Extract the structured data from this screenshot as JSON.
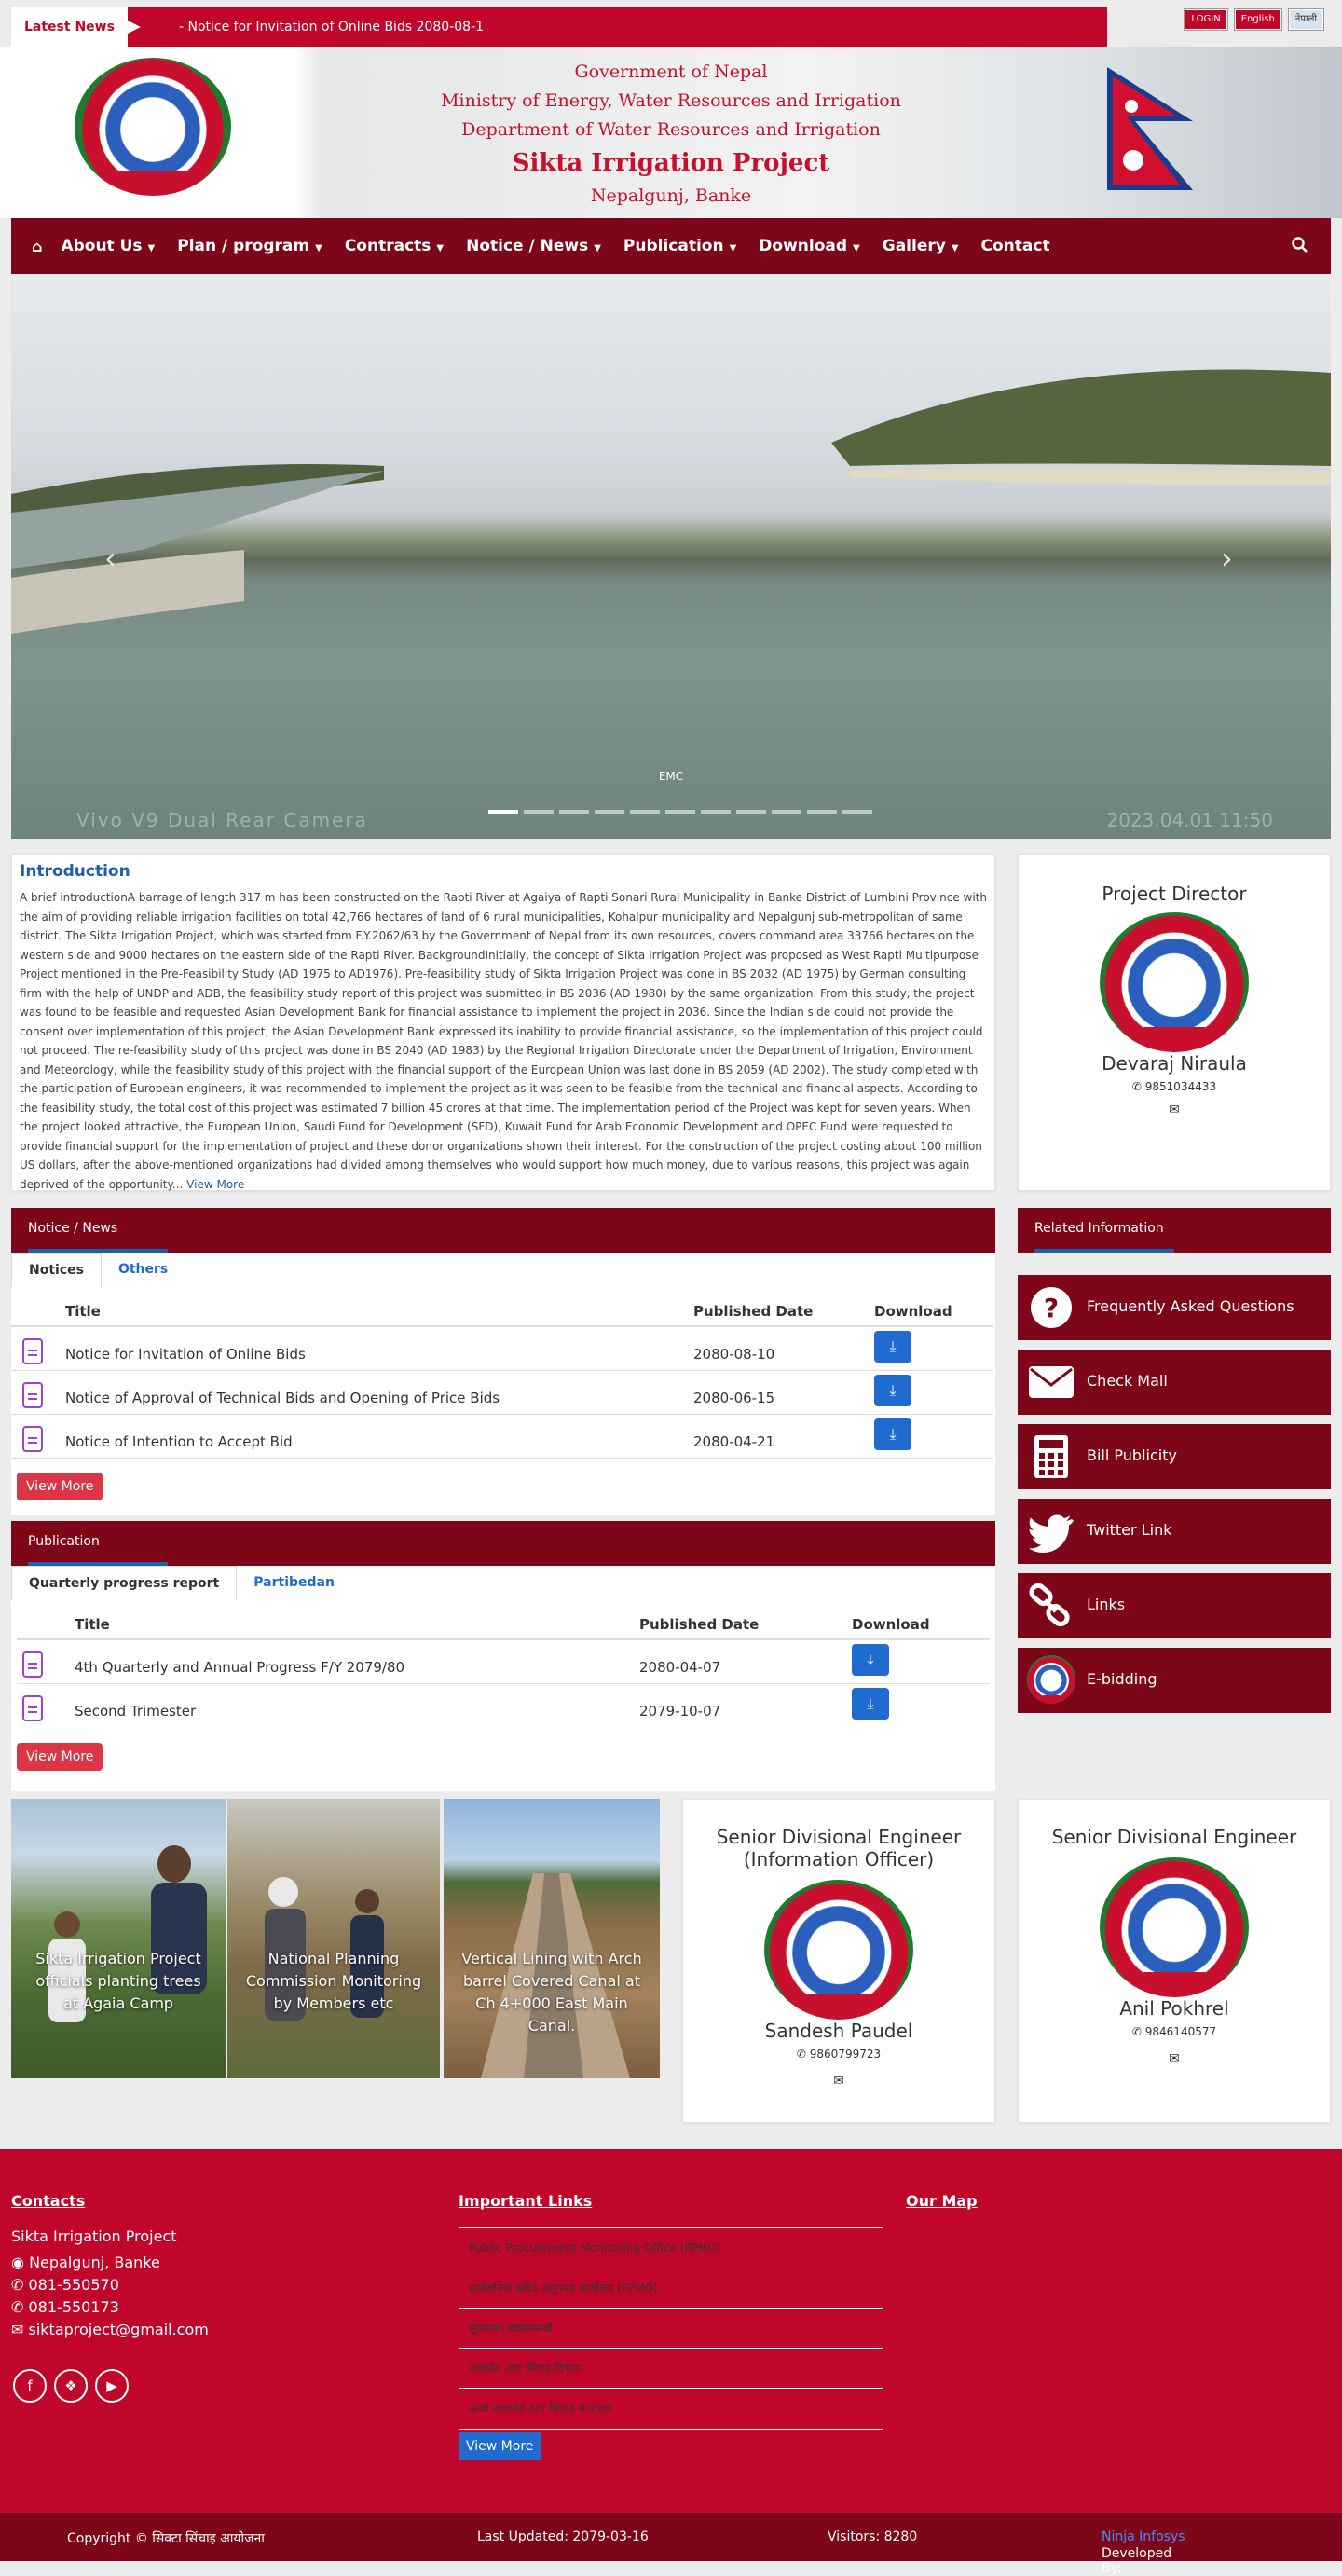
{
  "topbar": {
    "latest_label": "Latest News",
    "ticker_text": "-   Notice for Invitation of Online Bids 2080-08-1",
    "login_label": "LOGIN",
    "english_label": "English",
    "nepali_label": "नेपाली"
  },
  "header": {
    "line1": "Government of Nepal",
    "line2": "Ministry of Energy, Water Resources and Irrigation",
    "line3": "Department of Water Resources and Irrigation",
    "project": "Sikta Irrigation Project",
    "location": "Nepalgunj, Banke",
    "emblem_icon": "nepal-government-emblem",
    "flag_icon": "nepal-flag"
  },
  "nav": {
    "home_icon": "home-icon",
    "items": [
      {
        "label": "About Us"
      },
      {
        "label": "Plan / program"
      },
      {
        "label": "Contracts"
      },
      {
        "label": "Notice / News"
      },
      {
        "label": "Publication"
      },
      {
        "label": "Download"
      },
      {
        "label": "Gallery"
      },
      {
        "label": "Contact"
      }
    ],
    "search_icon": "search-icon"
  },
  "slider": {
    "caption": "EMC",
    "watermark": "Vivo V9 Dual Rear Camera",
    "timestamp": "2023.04.01  11:50",
    "slide_count": 11,
    "active_index": 0
  },
  "intro": {
    "title": "Introduction",
    "text": "A brief introductionA barrage of length 317 m has been constructed on the Rapti River at Agaiya of Rapti Sonari Rural Municipality in Banke District of Lumbini Province with the aim of providing reliable irrigation facilities on total 42,766 hectares of land of 6 rural municipalities, Kohalpur municipality and Nepalgunj sub-metropolitan of same district. The Sikta Irrigation Project, which was started from F.Y.2062/63 by the Government of Nepal from its own resources, covers command area 33766 hectares on the western side and 9000 hectares on the eastern side of the Rapti River. BackgroundInitially, the concept of Sikta Irrigation Project was proposed as West Rapti Multipurpose Project mentioned in the Pre-Feasibility Study (AD 1975 to AD1976). Pre-feasibility study of Sikta Irrigation Project was done in BS 2032 (AD 1975) by German consulting firm with the help of UNDP and ADB, the feasibility study report of this project was submitted in BS 2036 (AD 1980) by the same organization. From this study, the project was found to be feasible and requested Asian Development Bank for financial assistance to implement the project in 2036. Since the Indian side could not provide the consent over implementation of this project, the Asian Development Bank expressed its inability to provide financial assistance, so the implementation of this project could not proceed. The re-feasibility study of this project was done in BS 2040 (AD 1983) by the Regional Irrigation Directorate under the Department of Irrigation, Environment and Meteorology, while the feasibility study of this project with the financial support of the European Union was last done in BS 2059 (AD 2002). The study completed with the participation of European engineers, it was recommended to implement the project as it was seen to be feasible from the technical and financial aspects. According to the feasibility study, the total cost of this project was estimated 7 billion 45 crores at that time. The implementation period of the Project was kept for seven years. When the project looked attractive, the European Union, Saudi Fund for Development (SFD), Kuwait Fund for Arab Economic Development and OPEC Fund were requested to provide financial support for the implementation of project and these donor organizations shown their interest. For the construction of the project costing about 100 million US dollars, after the above-mentioned organizations had divided among themselves who would support how much money, due to various reasons, this project was again deprived of the opportunity...",
    "view_more": "View More"
  },
  "director": {
    "title": "Project Director",
    "name": "Devaraj Niraula",
    "phone": "9851034433",
    "phone_icon": "phone-icon",
    "mail_icon": "envelope-icon"
  },
  "notices": {
    "heading": "Notice / News",
    "tabs": [
      "Notices",
      "Others"
    ],
    "columns": [
      "Title",
      "Published Date",
      "Download"
    ],
    "rows": [
      {
        "title": "Notice for Invitation of Online Bids",
        "date": "2080-08-10"
      },
      {
        "title": "Notice of Approval of Technical Bids and Opening of Price Bids",
        "date": "2080-06-15"
      },
      {
        "title": "Notice of Intention to Accept Bid",
        "date": "2080-04-21"
      }
    ],
    "view_more": "View More"
  },
  "publication": {
    "heading": "Publication",
    "tabs": [
      "Quarterly progress report",
      "Partibedan"
    ],
    "columns": [
      "Title",
      "Published Date",
      "Download"
    ],
    "rows": [
      {
        "title": "4th Quarterly and Annual Progress F/Y 2079/80",
        "date": "2080-04-07"
      },
      {
        "title": "Second Trimester",
        "date": "2079-10-07"
      }
    ],
    "view_more": "View More"
  },
  "related": {
    "heading": "Related Information",
    "items": [
      {
        "label": "Frequently Asked Questions",
        "icon": "question-circle-icon"
      },
      {
        "label": "Check Mail",
        "icon": "envelope-icon"
      },
      {
        "label": "Bill Publicity",
        "icon": "calculator-icon"
      },
      {
        "label": "Twitter Link",
        "icon": "twitter-icon"
      },
      {
        "label": "Links",
        "icon": "link-icon"
      },
      {
        "label": "E-bidding",
        "icon": "nepal-government-emblem"
      }
    ]
  },
  "gallery": [
    {
      "caption": "Sikta Irrigation Project officials planting trees at Agaia Camp"
    },
    {
      "caption": "National Planning Commission Monitoring by Members etc"
    },
    {
      "caption": "Vertical Lining with Arch barrel Covered Canal at Ch 4+000 East Main Canal."
    }
  ],
  "officers": [
    {
      "title": "Senior Divisional Engineer (Information Officer)",
      "name": "Sandesh Paudel",
      "phone": "9860799723"
    },
    {
      "title": "Senior Divisional Engineer",
      "name": "Anil Pokhrel",
      "phone": "9846140577"
    }
  ],
  "footer": {
    "contacts_heading": "Contacts",
    "org": "Sikta Irrigation Project",
    "address": "Nepalgunj, Banke",
    "phone1": "081-550570",
    "phone2": "081-550173",
    "email": "siktaproject@gmail.com",
    "social": [
      "facebook-icon",
      "twitter-icon",
      "youtube-icon"
    ],
    "links_heading": "Important Links",
    "links": [
      "Public Procurement Monitoring Office (PPMO)",
      "सार्वजनिक खरिद अनुगमन कार्यालय (PPMO)",
      "सूचनाको हकसम्बन्धी",
      "जलस्रोत तथा सिंचाइ विभाग",
      "ऊर्जा जलस्रोत तथा सिंचाइ मन्त्रालय"
    ],
    "links_view_more": "View More",
    "map_heading": "Our Map"
  },
  "bottom": {
    "copyright": "Copyright © सिक्टा सिंचाइ आयोजना",
    "last_updated": "Last Updated: 2079-03-16",
    "visitors": "Visitors: 8280",
    "developed_by_label": "Developed By:",
    "developer": "Ninja Infosys"
  },
  "colors": {
    "brand_red": "#c0062b",
    "dark_maroon": "#7d0718",
    "link_blue": "#1f6bd0",
    "doc_icon_purple": "#a23fd6"
  }
}
